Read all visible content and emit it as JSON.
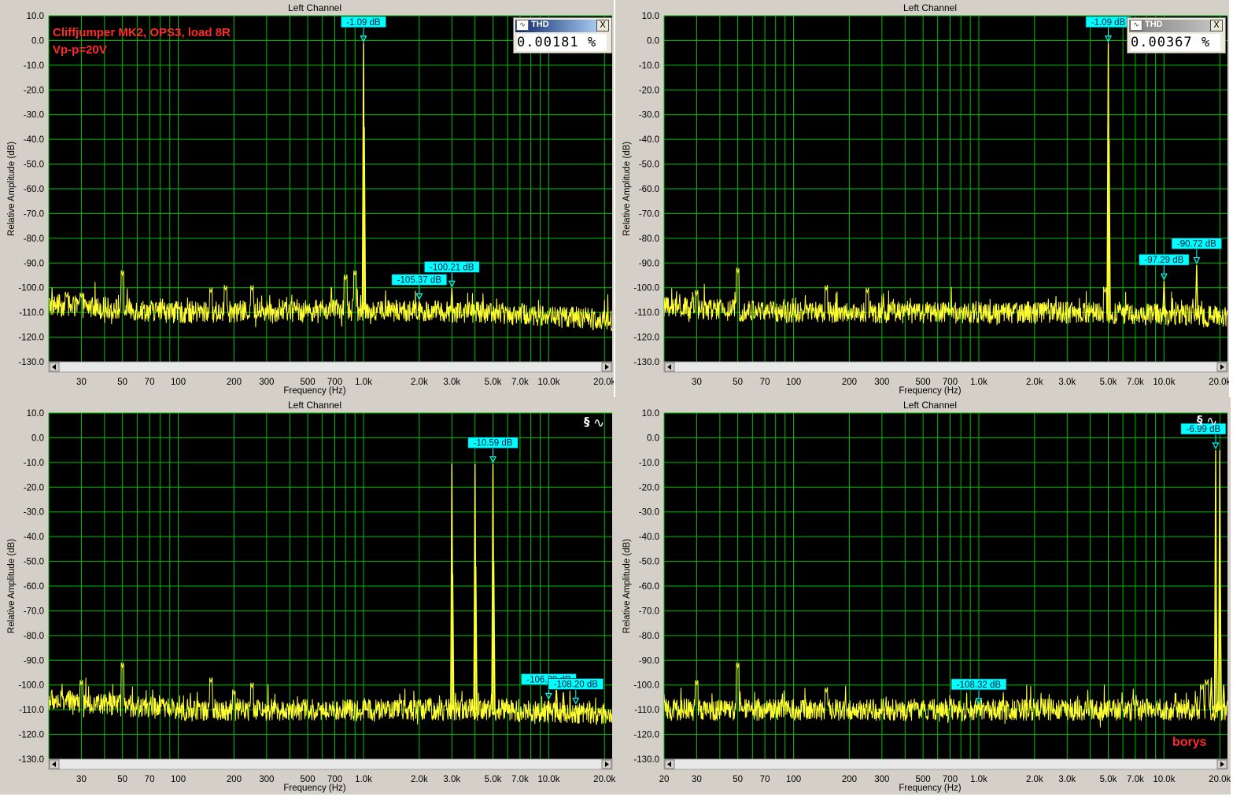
{
  "colors": {
    "trace": "#ffff33",
    "grid": "#00c000",
    "plot_bg": "#000000",
    "marker_bg": "#00ffff",
    "annotation": "#ff2a2a"
  },
  "overlays": {
    "note_line1": "Cliffjumper MK2, OPS3, load 8R",
    "note_line2": "Vp-p=20V",
    "signature": "borys",
    "thd_left": {
      "title": "THD",
      "value": "0.00181 %",
      "close": "X",
      "icon": "waveform-icon"
    },
    "thd_right": {
      "title": "THD",
      "value": "0.00367 %",
      "close": "X",
      "icon": "waveform-icon"
    },
    "generator_icon": "generator-icon"
  },
  "chart_data": [
    {
      "type": "line",
      "title": "Left Channel",
      "xlabel": "Frequency (Hz)",
      "ylabel": "Relative Amplitude (dB)",
      "x_scale": "log",
      "xlim": [
        20,
        22000
      ],
      "ylim": [
        -130,
        10
      ],
      "y_ticks": [
        "10.0",
        "0.0",
        "-10.0",
        "-20.0",
        "-30.0",
        "-40.0",
        "-50.0",
        "-60.0",
        "-70.0",
        "-80.0",
        "-90.0",
        "-100.0",
        "-110.0",
        "-120.0",
        "-130.0"
      ],
      "x_tick_labels": [
        {
          "f": 30,
          "t": "30"
        },
        {
          "f": 50,
          "t": "50"
        },
        {
          "f": 70,
          "t": "70"
        },
        {
          "f": 100,
          "t": "100"
        },
        {
          "f": 200,
          "t": "200"
        },
        {
          "f": 300,
          "t": "300"
        },
        {
          "f": 500,
          "t": "500"
        },
        {
          "f": 700,
          "t": "700"
        },
        {
          "f": 1000,
          "t": "1.0k"
        },
        {
          "f": 2000,
          "t": "2.0k"
        },
        {
          "f": 3000,
          "t": "3.0k"
        },
        {
          "f": 5000,
          "t": "5.0k"
        },
        {
          "f": 7000,
          "t": "7.0k"
        },
        {
          "f": 10000,
          "t": "10.0k"
        },
        {
          "f": 20000,
          "t": "20.0k"
        }
      ],
      "grid": true,
      "noise_floor_db": -110,
      "noise_tilt": [
        [
          20,
          -107
        ],
        [
          100,
          -110
        ],
        [
          1000,
          -109
        ],
        [
          5000,
          -110
        ],
        [
          22000,
          -113
        ]
      ],
      "noise_spurs": [
        [
          50,
          -95
        ],
        [
          30,
          -104
        ],
        [
          25,
          -104
        ],
        [
          150,
          -102
        ],
        [
          180,
          -101
        ],
        [
          250,
          -101
        ],
        [
          800,
          -97
        ],
        [
          900,
          -95
        ]
      ],
      "peaks": [
        [
          1000,
          -1.09
        ],
        [
          1010,
          -35
        ],
        [
          2000,
          -105.37
        ],
        [
          3000,
          -100.21
        ]
      ],
      "markers": [
        {
          "x": 1000,
          "y": -1.09,
          "label": "-1.09 dB"
        },
        {
          "x": 2000,
          "y": -105.37,
          "label": "-105.37 dB"
        },
        {
          "x": 3000,
          "y": -100.21,
          "label": "-100.21 dB"
        }
      ]
    },
    {
      "type": "line",
      "title": "Left Channel",
      "xlabel": "Frequency (Hz)",
      "ylabel": "Relative Amplitude (dB)",
      "x_scale": "log",
      "xlim": [
        20,
        22000
      ],
      "ylim": [
        -130,
        10
      ],
      "y_ticks": [
        "10.0",
        "0.0",
        "-10.0",
        "-20.0",
        "-30.0",
        "-40.0",
        "-50.0",
        "-60.0",
        "-70.0",
        "-80.0",
        "-90.0",
        "-100.0",
        "-110.0",
        "-120.0",
        "-130.0"
      ],
      "x_tick_labels": [
        {
          "f": 30,
          "t": "30"
        },
        {
          "f": 50,
          "t": "50"
        },
        {
          "f": 70,
          "t": "70"
        },
        {
          "f": 100,
          "t": "100"
        },
        {
          "f": 200,
          "t": "200"
        },
        {
          "f": 300,
          "t": "300"
        },
        {
          "f": 500,
          "t": "500"
        },
        {
          "f": 700,
          "t": "700"
        },
        {
          "f": 1000,
          "t": "1.0k"
        },
        {
          "f": 2000,
          "t": "2.0k"
        },
        {
          "f": 3000,
          "t": "3.0k"
        },
        {
          "f": 5000,
          "t": "5.0k"
        },
        {
          "f": 7000,
          "t": "7.0k"
        },
        {
          "f": 10000,
          "t": "10.0k"
        },
        {
          "f": 20000,
          "t": "20.0k"
        }
      ],
      "grid": true,
      "noise_floor_db": -110,
      "noise_tilt": [
        [
          20,
          -108
        ],
        [
          100,
          -110
        ],
        [
          1000,
          -110
        ],
        [
          5000,
          -110
        ],
        [
          22000,
          -112
        ]
      ],
      "noise_spurs": [
        [
          50,
          -94
        ],
        [
          30,
          -103
        ],
        [
          150,
          -101
        ],
        [
          250,
          -102
        ],
        [
          4800,
          -102
        ]
      ],
      "peaks": [
        [
          5000,
          -1.09
        ],
        [
          5050,
          -40
        ],
        [
          10000,
          -97.29
        ],
        [
          15000,
          -90.72
        ]
      ],
      "markers": [
        {
          "x": 5000,
          "y": -1.09,
          "label": "-1.09 dB"
        },
        {
          "x": 10000,
          "y": -97.29,
          "label": "-97.29 dB"
        },
        {
          "x": 15000,
          "y": -90.72,
          "label": "-90.72 dB"
        }
      ]
    },
    {
      "type": "line",
      "title": "Left Channel",
      "xlabel": "Frequency (Hz)",
      "ylabel": "Relative Amplitude (dB)",
      "x_scale": "log",
      "xlim": [
        20,
        22000
      ],
      "ylim": [
        -130,
        10
      ],
      "y_ticks": [
        "10.0",
        "0.0",
        "-10.0",
        "-20.0",
        "-30.0",
        "-40.0",
        "-50.0",
        "-60.0",
        "-70.0",
        "-80.0",
        "-90.0",
        "-100.0",
        "-110.0",
        "-120.0",
        "-130.0"
      ],
      "x_tick_labels": [
        {
          "f": 30,
          "t": "30"
        },
        {
          "f": 50,
          "t": "50"
        },
        {
          "f": 70,
          "t": "70"
        },
        {
          "f": 100,
          "t": "100"
        },
        {
          "f": 200,
          "t": "200"
        },
        {
          "f": 300,
          "t": "300"
        },
        {
          "f": 500,
          "t": "500"
        },
        {
          "f": 700,
          "t": "700"
        },
        {
          "f": 1000,
          "t": "1.0k"
        },
        {
          "f": 2000,
          "t": "2.0k"
        },
        {
          "f": 3000,
          "t": "3.0k"
        },
        {
          "f": 5000,
          "t": "5.0k"
        },
        {
          "f": 7000,
          "t": "7.0k"
        },
        {
          "f": 10000,
          "t": "10.0k"
        },
        {
          "f": 20000,
          "t": "20.0k"
        }
      ],
      "grid": true,
      "noise_floor_db": -110,
      "noise_tilt": [
        [
          20,
          -106
        ],
        [
          100,
          -110
        ],
        [
          1000,
          -110
        ],
        [
          5000,
          -110
        ],
        [
          22000,
          -112
        ]
      ],
      "noise_spurs": [
        [
          50,
          -93
        ],
        [
          30,
          -100
        ],
        [
          150,
          -99
        ],
        [
          250,
          -101
        ],
        [
          200,
          -104
        ]
      ],
      "peaks": [
        [
          3000,
          -10.5
        ],
        [
          3030,
          -55
        ],
        [
          4000,
          -10.6
        ],
        [
          4040,
          -52
        ],
        [
          5000,
          -10.59
        ],
        [
          5050,
          -50
        ],
        [
          10000,
          -106.28
        ],
        [
          11000,
          -101
        ],
        [
          12000,
          -103
        ],
        [
          14000,
          -108.2
        ]
      ],
      "markers": [
        {
          "x": 5000,
          "y": -10.59,
          "label": "-10.59 dB"
        },
        {
          "x": 10000,
          "y": -106.28,
          "label": "-106.28 dB"
        },
        {
          "x": 14000,
          "y": -108.2,
          "label": "-108.20 dB"
        }
      ]
    },
    {
      "type": "line",
      "title": "Left Channel",
      "xlabel": "Frequency (Hz)",
      "ylabel": "Relative Amplitude (dB)",
      "x_scale": "log",
      "xlim": [
        20,
        22000
      ],
      "ylim": [
        -130,
        10
      ],
      "y_ticks": [
        "10.0",
        "0.0",
        "-10.0",
        "-20.0",
        "-30.0",
        "-40.0",
        "-50.0",
        "-60.0",
        "-70.0",
        "-80.0",
        "-90.0",
        "-100.0",
        "-110.0",
        "-120.0",
        "-130.0"
      ],
      "x_tick_labels": [
        {
          "f": 20,
          "t": "20"
        },
        {
          "f": 30,
          "t": "30"
        },
        {
          "f": 50,
          "t": "50"
        },
        {
          "f": 70,
          "t": "70"
        },
        {
          "f": 100,
          "t": "100"
        },
        {
          "f": 200,
          "t": "200"
        },
        {
          "f": 300,
          "t": "300"
        },
        {
          "f": 500,
          "t": "500"
        },
        {
          "f": 700,
          "t": "700"
        },
        {
          "f": 1000,
          "t": "1.0k"
        },
        {
          "f": 2000,
          "t": "2.0k"
        },
        {
          "f": 3000,
          "t": "3.0k"
        },
        {
          "f": 5000,
          "t": "5.0k"
        },
        {
          "f": 7000,
          "t": "7.0k"
        },
        {
          "f": 10000,
          "t": "10.0k"
        },
        {
          "f": 20000,
          "t": "20.0k"
        }
      ],
      "grid": true,
      "noise_floor_db": -110,
      "noise_tilt": [
        [
          20,
          -110
        ],
        [
          100,
          -110
        ],
        [
          1000,
          -110
        ],
        [
          5000,
          -110
        ],
        [
          22000,
          -110
        ]
      ],
      "noise_spurs": [
        [
          50,
          -93
        ],
        [
          30,
          -100
        ],
        [
          150,
          -103
        ],
        [
          16000,
          -102
        ],
        [
          17000,
          -100
        ]
      ],
      "peaks": [
        [
          19000,
          -5.0
        ],
        [
          19100,
          -60
        ],
        [
          20000,
          -5.0
        ],
        [
          20100,
          -60
        ],
        [
          18000,
          -97
        ],
        [
          21000,
          -100
        ],
        [
          1000,
          -108.32
        ]
      ],
      "markers": [
        {
          "x": 1000,
          "y": -108.32,
          "label": "-108.32 dB"
        },
        {
          "x": 19000,
          "y": -5.0,
          "label": "-6.99 dB"
        }
      ]
    }
  ]
}
